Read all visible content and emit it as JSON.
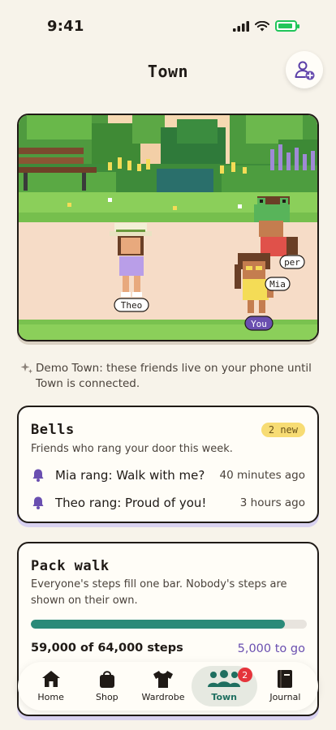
{
  "status_bar": {
    "time": "9:41"
  },
  "header": {
    "title": "Town"
  },
  "scene": {
    "labels": {
      "theo": "Theo",
      "mia": "Mia",
      "other": "per",
      "you": "You"
    }
  },
  "demo_note": {
    "text": "Demo Town: these friends live on your phone until Town is connected."
  },
  "bells": {
    "title": "Bells",
    "badge": "2 new",
    "subtitle": "Friends who rang your door this week.",
    "items": [
      {
        "message": "Mia rang: Walk with me?",
        "time": "40 minutes ago"
      },
      {
        "message": "Theo rang: Proud of you!",
        "time": "3 hours ago"
      }
    ]
  },
  "pack_walk": {
    "title": "Pack walk",
    "subtitle": "Everyone's steps fill one bar. Nobody's steps are shown on their own.",
    "progress_fraction": 0.922,
    "steps_total": "59,000 of 64,000 steps",
    "steps_remaining": "5,000 to go"
  },
  "tabs": [
    {
      "label": "Home",
      "icon": "home-icon"
    },
    {
      "label": "Shop",
      "icon": "shopping-bag-icon"
    },
    {
      "label": "Wardrobe",
      "icon": "tshirt-icon"
    },
    {
      "label": "Town",
      "icon": "people-icon",
      "badge": "2",
      "active": true
    },
    {
      "label": "Journal",
      "icon": "book-icon"
    }
  ],
  "colors": {
    "accent": "#2a8a79",
    "purple": "#6a4fb0",
    "badge": "#e5343b",
    "background": "#f7f3ea"
  }
}
